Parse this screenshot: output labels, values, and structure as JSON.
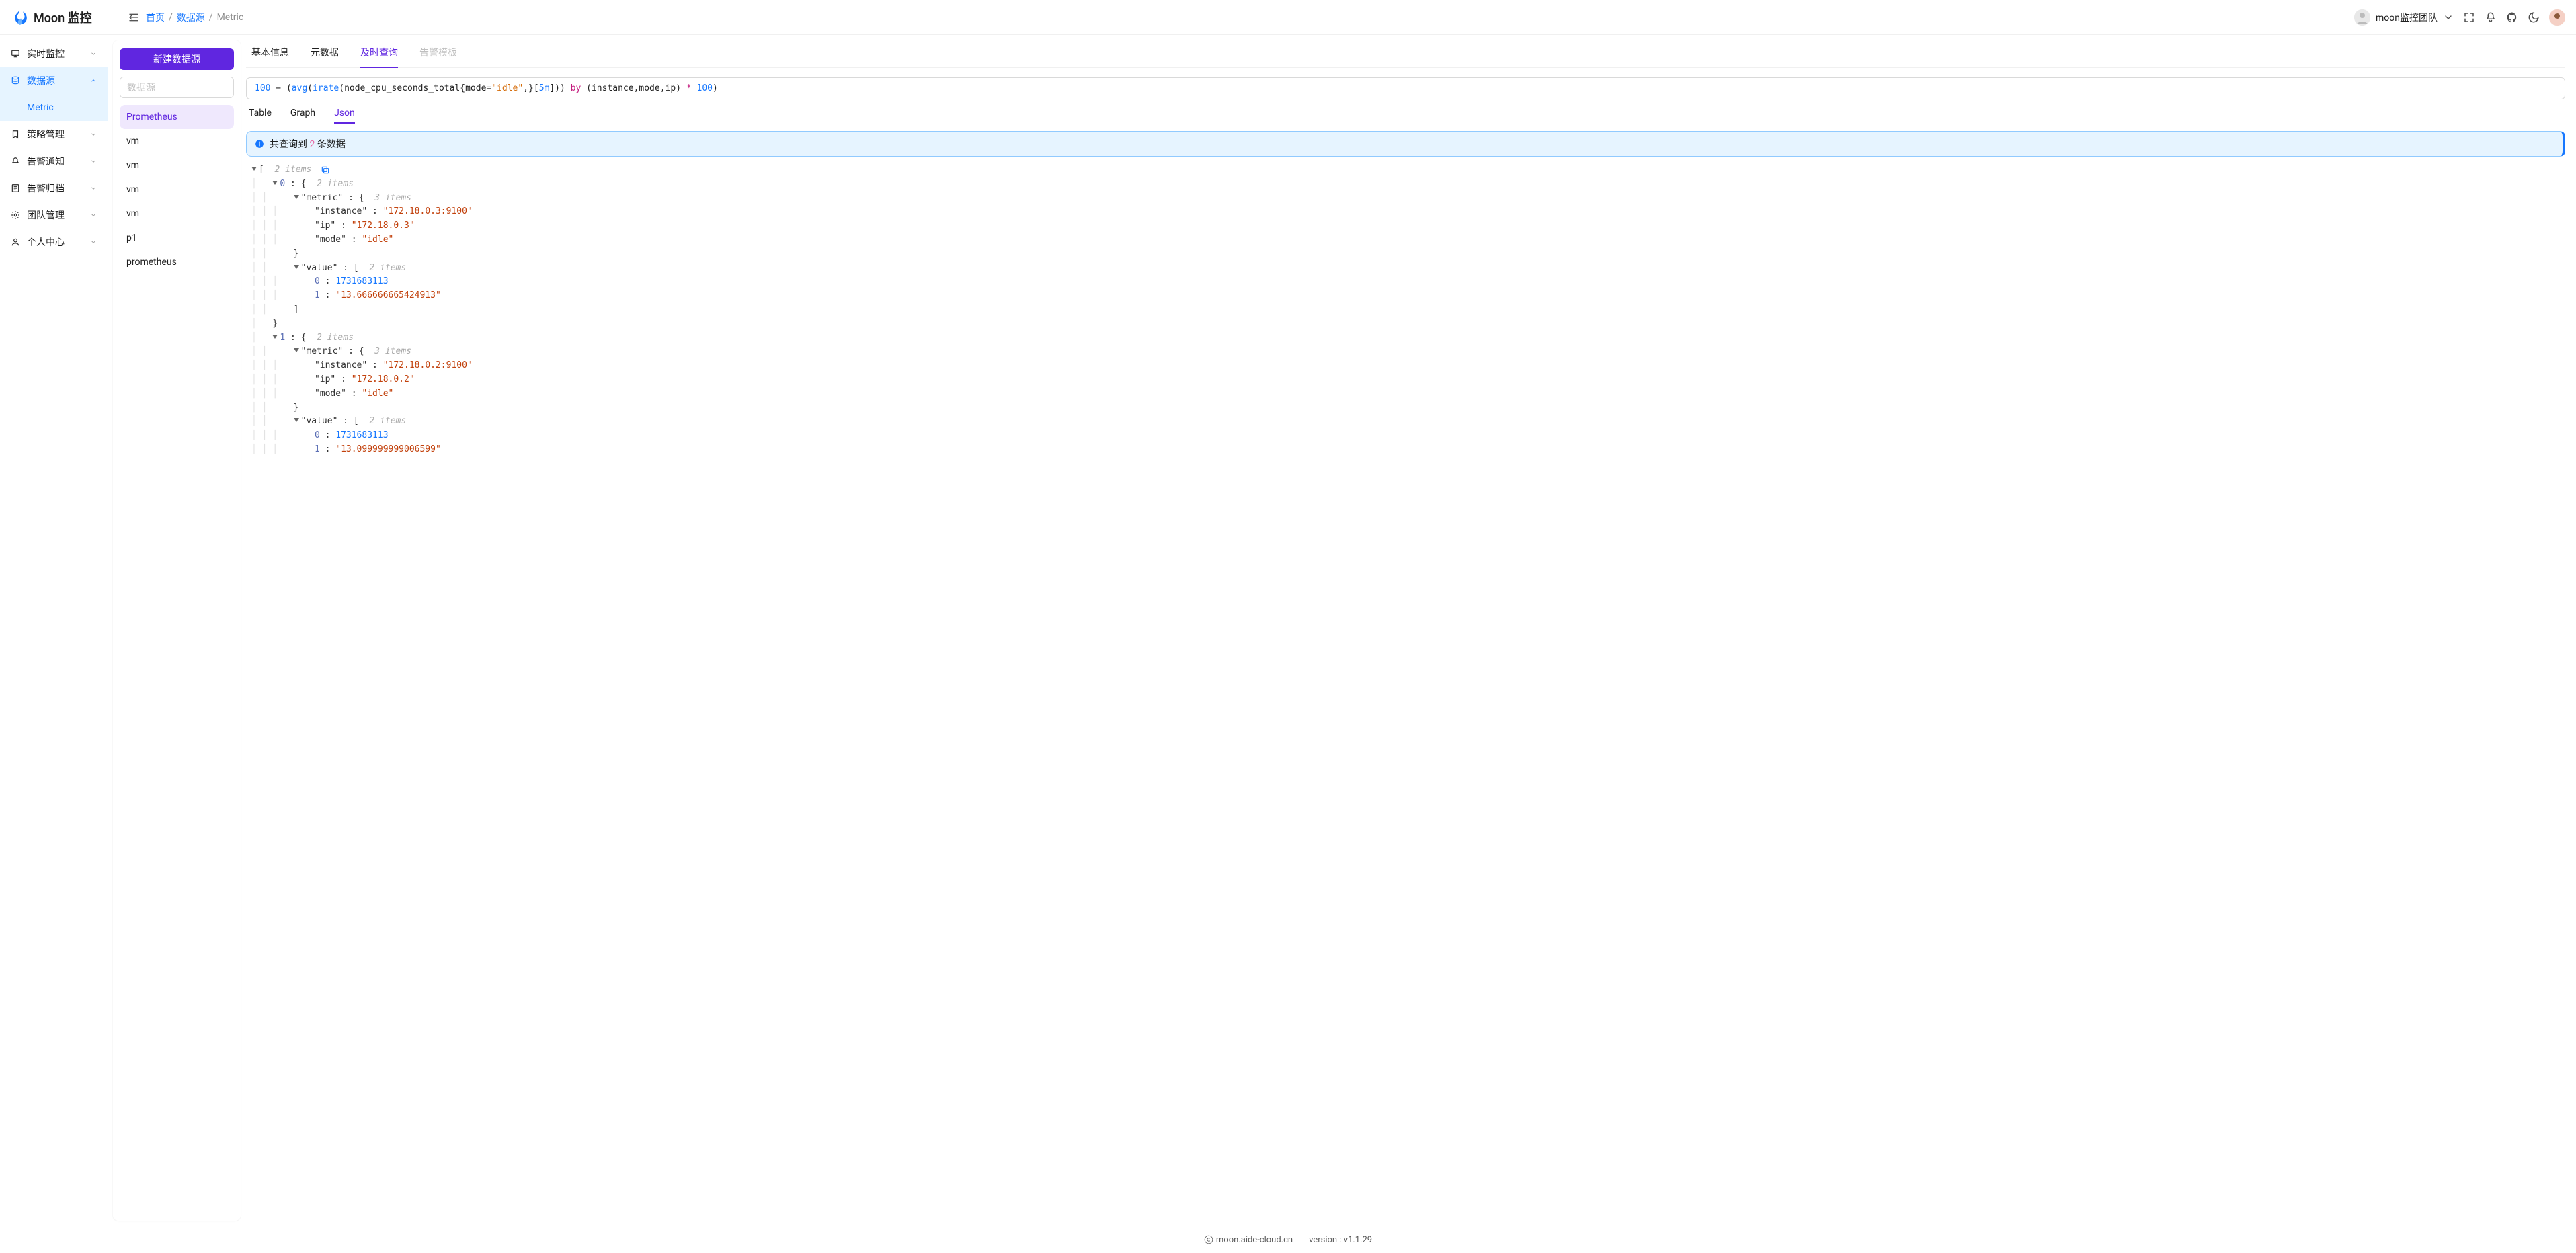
{
  "app": {
    "title": "Moon 监控"
  },
  "breadcrumbs": {
    "home": "首页",
    "ds": "数据源",
    "current": "Metric"
  },
  "header": {
    "team_name": "moon监控团队"
  },
  "sidebar": {
    "items": [
      {
        "label": "实时监控"
      },
      {
        "label": "数据源",
        "sub": "Metric"
      },
      {
        "label": "策略管理"
      },
      {
        "label": "告警通知"
      },
      {
        "label": "告警归档"
      },
      {
        "label": "团队管理"
      },
      {
        "label": "个人中心"
      }
    ]
  },
  "midpanel": {
    "new_btn": "新建数据源",
    "search_placeholder": "数据源",
    "datasources": [
      "Prometheus",
      "vm",
      "vm",
      "vm",
      "vm",
      "p1",
      "prometheus"
    ]
  },
  "tabs": {
    "t0": "基本信息",
    "t1": "元数据",
    "t2": "及时查询",
    "t3": "告警模板"
  },
  "subtabs": {
    "s0": "Table",
    "s1": "Graph",
    "s2": "Json"
  },
  "query": {
    "n100a": "100",
    "minus": " − (",
    "avg": "avg",
    "p1": "(",
    "irate": "irate",
    "p2": "(node_cpu_seconds_total{mode=",
    "idle": "\"idle\"",
    "p3": ",}[",
    "dur": "5m",
    "p4": "])) ",
    "by": "by",
    "p5": " (instance,mode,ip) ",
    "star": "*",
    "sp": " ",
    "n100b": "100",
    "p6": ")"
  },
  "alert": {
    "prefix": "共查询到 ",
    "count": "2",
    "suffix": " 条数据"
  },
  "json_meta": {
    "items2": "2 items",
    "items3": "3 items"
  },
  "result": [
    {
      "metric": {
        "instance": "\"172.18.0.3:9100\"",
        "ip": "\"172.18.0.3\"",
        "mode": "\"idle\""
      },
      "value": {
        "ts": "1731683113",
        "val": "\"13.666666665424913\""
      }
    },
    {
      "metric": {
        "instance": "\"172.18.0.2:9100\"",
        "ip": "\"172.18.0.2\"",
        "mode": "\"idle\""
      },
      "value": {
        "ts": "1731683113",
        "val": "\"13.099999999006599\""
      }
    }
  ],
  "footer": {
    "site": "moon.aide-cloud.cn",
    "version_label": "version :",
    "version": "v1.1.29"
  }
}
